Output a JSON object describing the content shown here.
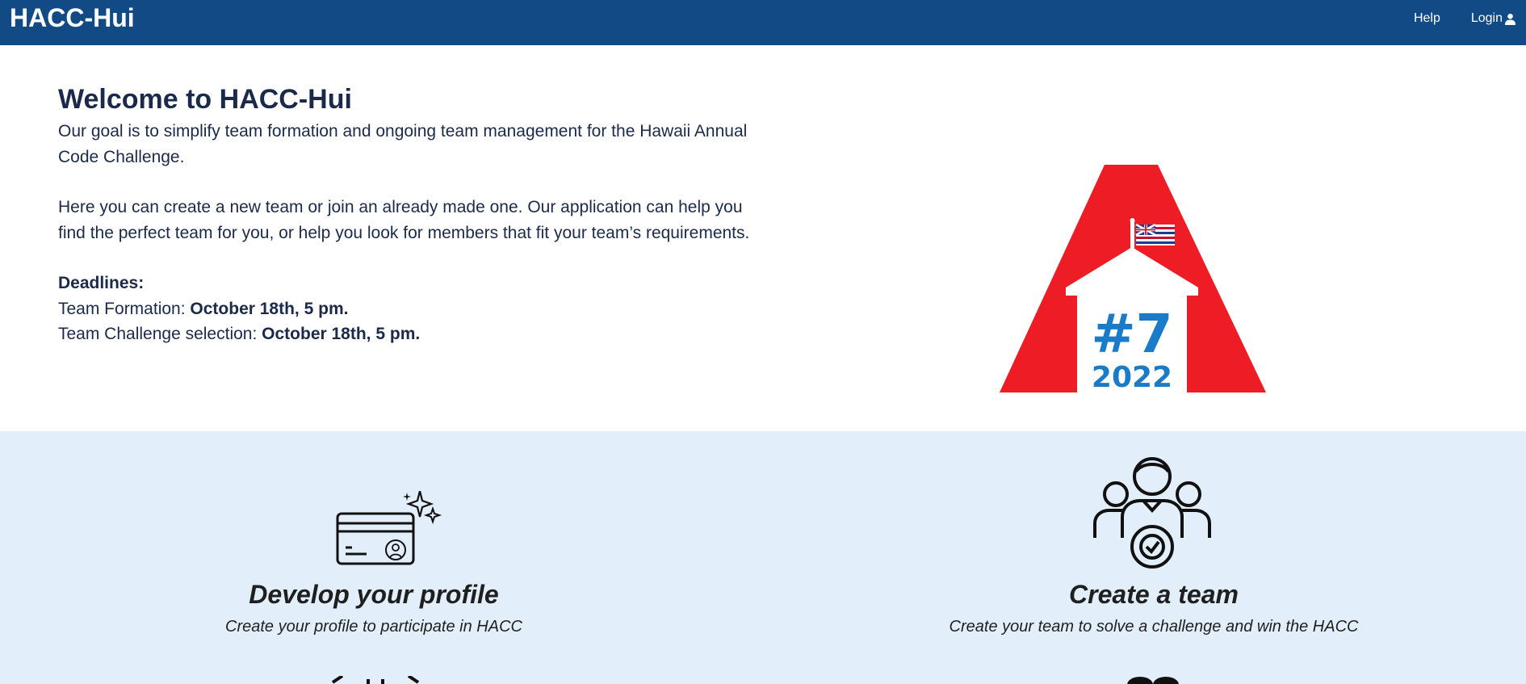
{
  "navbar": {
    "brand": "HACC-Hui",
    "help": "Help",
    "login": "Login",
    "login_icon": "user-icon"
  },
  "hero": {
    "title": "Welcome to HACC-Hui",
    "para1": "Our goal is to simplify team formation and ongoing team management for the Hawaii Annual Code Challenge.",
    "para2": "Here you can create a new team or join an already made one. Our application can help you find the perfect team for you, or help you look for members that fit your team’s requirements.",
    "deadlines_label": "Deadlines:",
    "team_formation_label": "Team Formation:",
    "team_formation_date": "October 18th, 5 pm.",
    "challenge_label": "Team Challenge selection:",
    "challenge_date": "October 18th, 5 pm."
  },
  "logo": {
    "number": "#7",
    "year": "2022",
    "colors": {
      "red": "#ee1c25",
      "blue": "#1a7bc9"
    }
  },
  "features": [
    {
      "icon": "id-card-sparkle-icon",
      "title": "Develop your profile",
      "desc": "Create your profile to participate in HACC"
    },
    {
      "icon": "team-check-icon",
      "title": "Create a team",
      "desc": "Create your team to solve a challenge and win the HACC"
    }
  ],
  "colors": {
    "navbar": "#124a86",
    "features_bg": "#e3eefb",
    "text": "#1b2a4a"
  }
}
